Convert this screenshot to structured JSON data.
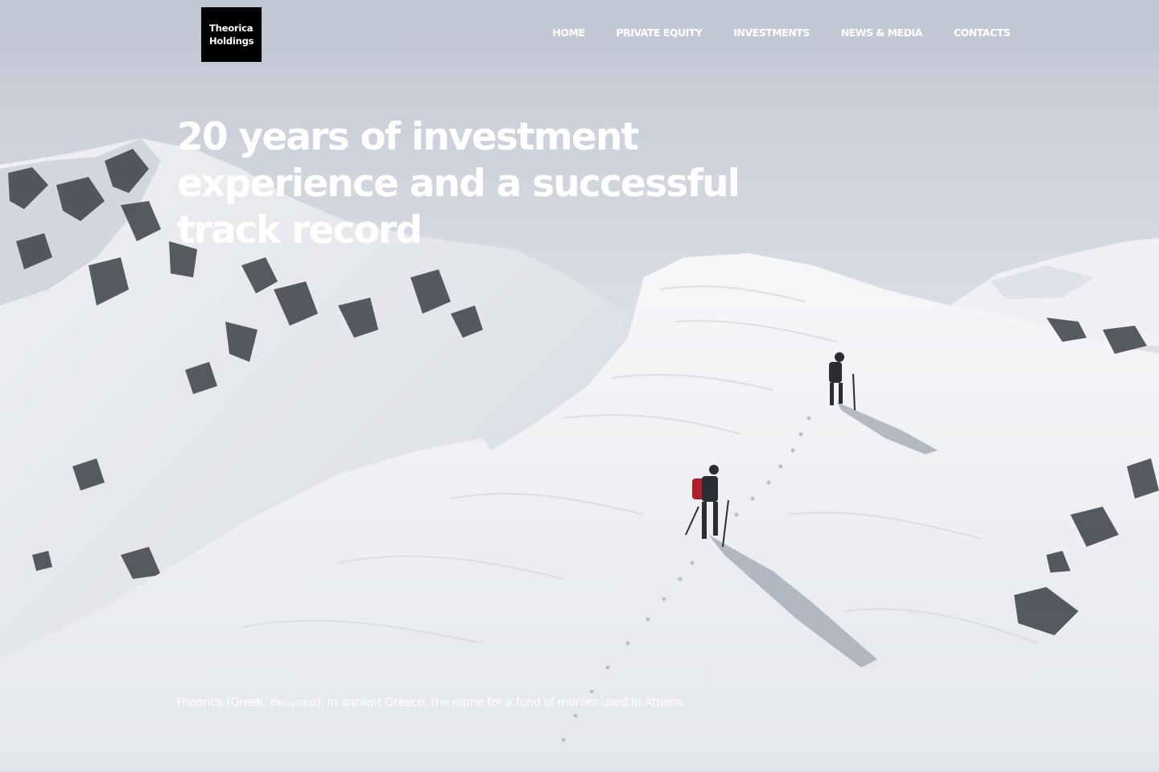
{
  "brand": {
    "line1": "Theorica",
    "line2": "Holdings",
    "background": "#000000",
    "text_color": "#ffffff"
  },
  "nav": {
    "items": [
      {
        "label": "HOME"
      },
      {
        "label": "PRIVATE EQUITY"
      },
      {
        "label": "INVESTMENTS"
      },
      {
        "label": "NEWS & MEDIA"
      },
      {
        "label": "CONTACTS"
      }
    ]
  },
  "hero": {
    "headline_lines": [
      "20 years of investment",
      "experience and a successful",
      "track record"
    ],
    "caption_prefix": "Theorica (Greek: ",
    "caption_greek": "Θεωρικά",
    "caption_suffix": "): in ancient Greece, the name for a fund of monies used in Athens",
    "background_image": "snowy-mountain-ridge-with-two-climbers"
  },
  "colors": {
    "text": "#ffffff",
    "sky": "#c9ced8",
    "snow": "#f2f3f5"
  }
}
